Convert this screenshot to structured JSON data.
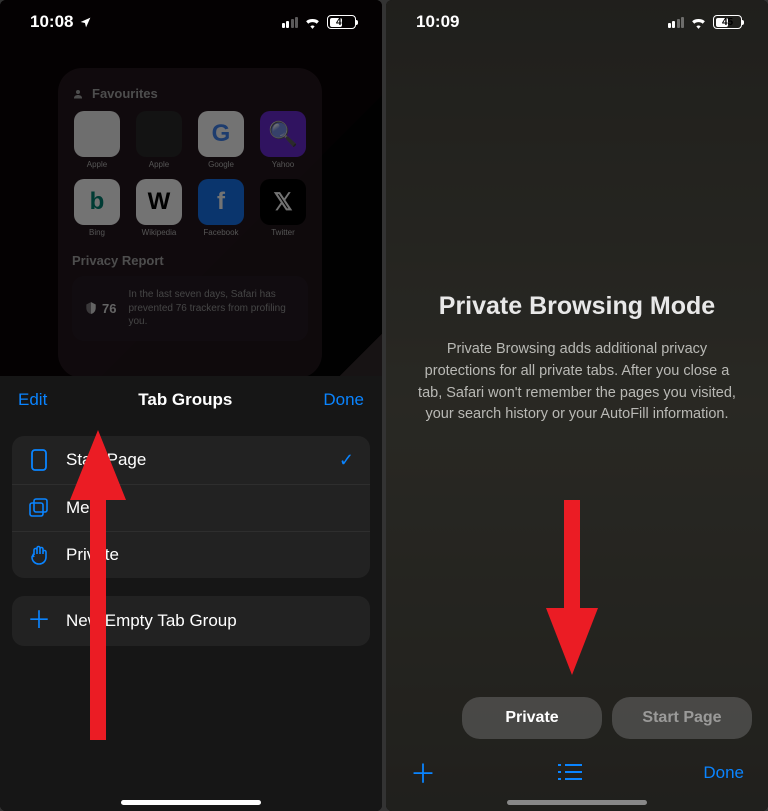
{
  "left": {
    "status": {
      "time": "10:08",
      "battery": "46"
    },
    "favourites_label": "Favourites",
    "apps": [
      {
        "label": "Apple",
        "bg": "#f4f4f4",
        "fg": "#333",
        "glyph": ""
      },
      {
        "label": "Apple",
        "bg": "#2a2a2a",
        "fg": "#bbb",
        "glyph": ""
      },
      {
        "label": "Google",
        "bg": "#ffffff",
        "fg": "#4285F4",
        "glyph": "G"
      },
      {
        "label": "Yahoo",
        "bg": "#6b2bd6",
        "fg": "#fff",
        "glyph": "🔍"
      },
      {
        "label": "Bing",
        "bg": "#ffffff",
        "fg": "#008373",
        "glyph": "b"
      },
      {
        "label": "Wikipedia",
        "bg": "#ffffff",
        "fg": "#000",
        "glyph": "W"
      },
      {
        "label": "Facebook",
        "bg": "#1877f2",
        "fg": "#fff",
        "glyph": "f"
      },
      {
        "label": "Twitter",
        "bg": "#000000",
        "fg": "#fff",
        "glyph": "𝕏"
      }
    ],
    "privacy_report_label": "Privacy Report",
    "privacy_count": "76",
    "privacy_desc": "In the last seven days, Safari has prevented 76 trackers from profiling you.",
    "sheet": {
      "edit": "Edit",
      "title": "Tab Groups",
      "done": "Done",
      "items": [
        {
          "label": "Start Page",
          "selected": true
        },
        {
          "label": "Me",
          "selected": false
        },
        {
          "label": "Private",
          "selected": false
        }
      ],
      "new_group": "New Empty Tab Group"
    }
  },
  "right": {
    "status": {
      "time": "10:09",
      "battery": "45"
    },
    "title": "Private Browsing Mode",
    "desc": "Private Browsing adds additional privacy protections for all private tabs. After you close a tab, Safari won't remember the pages you visited, your search history or your AutoFill information.",
    "pill_private": "Private",
    "pill_start": "Start Page",
    "done": "Done"
  }
}
